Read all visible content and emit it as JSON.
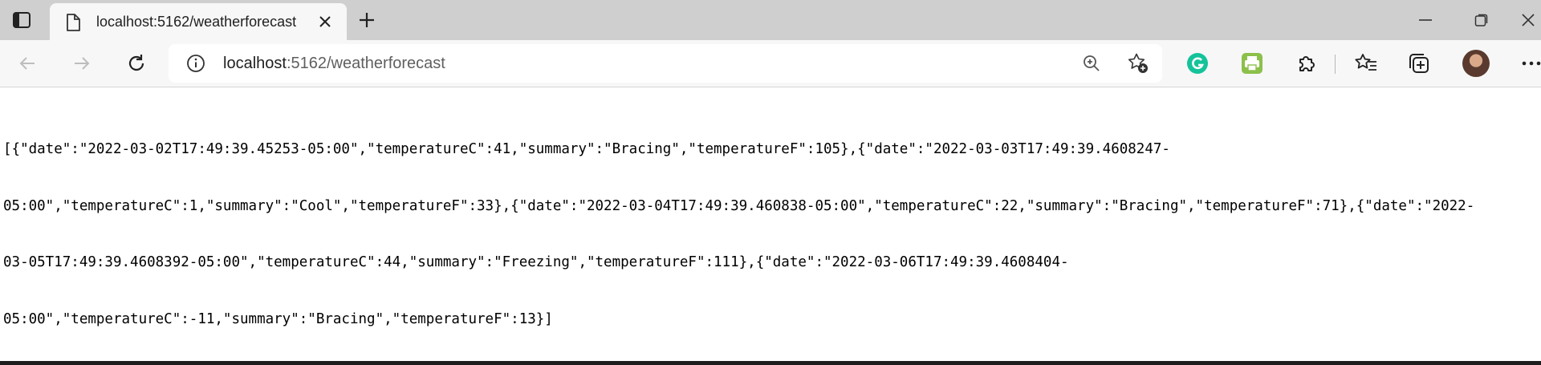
{
  "tab": {
    "title": "localhost:5162/weatherforecast"
  },
  "address": {
    "host": "localhost",
    "rest": ":5162/weatherforecast"
  },
  "content": {
    "lines": [
      "[{\"date\":\"2022-03-02T17:49:39.45253-05:00\",\"temperatureC\":41,\"summary\":\"Bracing\",\"temperatureF\":105},{\"date\":\"2022-03-03T17:49:39.4608247-",
      "05:00\",\"temperatureC\":1,\"summary\":\"Cool\",\"temperatureF\":33},{\"date\":\"2022-03-04T17:49:39.460838-05:00\",\"temperatureC\":22,\"summary\":\"Bracing\",\"temperatureF\":71},{\"date\":\"2022-",
      "03-05T17:49:39.4608392-05:00\",\"temperatureC\":44,\"summary\":\"Freezing\",\"temperatureF\":111},{\"date\":\"2022-03-06T17:49:39.4608404-",
      "05:00\",\"temperatureC\":-11,\"summary\":\"Bracing\",\"temperatureF\":13}]"
    ]
  },
  "icons": {
    "tab_actions": "tab-actions-icon",
    "page": "page-icon",
    "close": "close-icon",
    "new_tab": "plus-icon",
    "minimize": "minimize-icon",
    "restore": "restore-icon",
    "window_close": "window-close-icon",
    "back": "back-arrow-icon",
    "forward": "forward-arrow-icon",
    "refresh": "refresh-icon",
    "info": "info-icon",
    "zoom": "zoom-icon",
    "add_favorite": "star-add-icon",
    "grammarly": "grammarly-icon",
    "printer_ext": "printer-extension-icon",
    "extensions": "puzzle-icon",
    "favorites": "favorites-icon",
    "collections": "collections-icon",
    "profile": "profile-avatar",
    "more": "more-icon"
  },
  "colors": {
    "grammarly": "#15c39a",
    "printer_ext": "#8cc04b",
    "titlebar": "#cfcfcf",
    "toolbar": "#f7f7f7"
  }
}
